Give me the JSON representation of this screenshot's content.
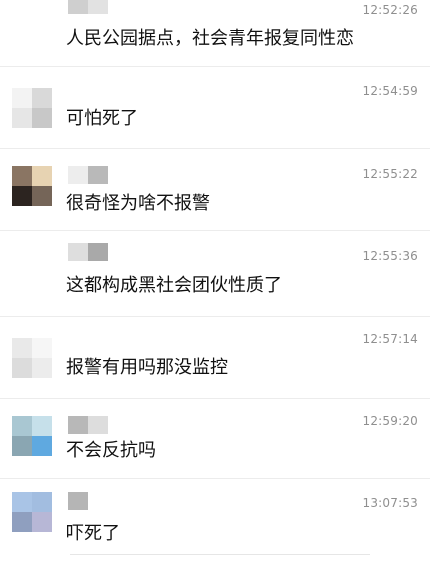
{
  "messages": [
    {
      "time": "12:52:26",
      "text": "人民公园据点，社会青年报复同性恋",
      "avatar_colors": [],
      "name_colors": [
        "#cfcfcf",
        "#e2e2e2"
      ]
    },
    {
      "time": "12:54:59",
      "text": "可怕死了",
      "avatar_colors": [
        "#f3f3f3",
        "#d9d9d9",
        "#e6e6e6",
        "#c8c8c8"
      ],
      "name_colors": []
    },
    {
      "time": "12:55:22",
      "text": "很奇怪为啥不报警",
      "avatar_colors": [
        "#8a7563",
        "#e7d3b2",
        "#2c2420",
        "#756558"
      ],
      "name_colors": [
        "#ededed",
        "#b9b9b9"
      ]
    },
    {
      "time": "12:55:36",
      "text": "这都构成黑社会团伙性质了",
      "avatar_colors": [],
      "name_colors": [
        "#dedede",
        "#a9a9a9"
      ]
    },
    {
      "time": "12:57:14",
      "text": "报警有用吗那没监控",
      "avatar_colors": [
        "#e9e9e9",
        "#f6f6f6",
        "#dcdcdc",
        "#ececec"
      ],
      "name_colors": []
    },
    {
      "time": "12:59:20",
      "text": "不会反抗吗",
      "avatar_colors": [
        "#a9c7d2",
        "#c6e0ea",
        "#8aa6b2",
        "#5fa9e0"
      ],
      "name_colors": [
        "#b8b8b8",
        "#dddddd"
      ]
    },
    {
      "time": "13:07:53",
      "text": "吓死了",
      "avatar_colors": [
        "#a9c4e6",
        "#a2bde0",
        "#8f9fbf",
        "#b7b7d6"
      ],
      "name_colors": [
        "#b5b5b5",
        "#ffffff"
      ]
    }
  ]
}
